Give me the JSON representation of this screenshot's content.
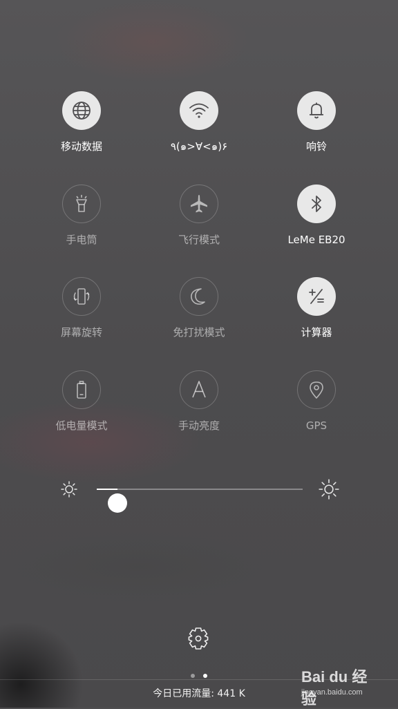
{
  "tiles": [
    {
      "label": "移动数据",
      "icon": "globe-icon",
      "state": "on"
    },
    {
      "label": "٩(๑>∀<๑)۶",
      "icon": "wifi-icon",
      "state": "on"
    },
    {
      "label": "响铃",
      "icon": "bell-icon",
      "state": "on"
    },
    {
      "label": "手电筒",
      "icon": "flashlight-icon",
      "state": "off"
    },
    {
      "label": "飞行模式",
      "icon": "airplane-icon",
      "state": "off"
    },
    {
      "label": "LeMe EB20",
      "icon": "bluetooth-icon",
      "state": "on"
    },
    {
      "label": "屏幕旋转",
      "icon": "rotate-icon",
      "state": "off"
    },
    {
      "label": "免打扰模式",
      "icon": "moon-icon",
      "state": "off"
    },
    {
      "label": "计算器",
      "icon": "calculator-icon",
      "state": "on"
    },
    {
      "label": "低电量模式",
      "icon": "battery-icon",
      "state": "off"
    },
    {
      "label": "手动亮度",
      "icon": "letter-a-icon",
      "state": "off"
    },
    {
      "label": "GPS",
      "icon": "location-pin-icon",
      "state": "off"
    }
  ],
  "brightness": {
    "level": 0.1
  },
  "pager": {
    "current": 2,
    "total": 2
  },
  "usage": {
    "text": "今日已用流量: 441 K"
  },
  "watermark": {
    "logo": "Bai du 经验",
    "url": "jingyan.baidu.com"
  },
  "colors": {
    "background": "#4f4e50",
    "active_circle": "#e8e8e8",
    "active_icon": "#4f4e50"
  }
}
